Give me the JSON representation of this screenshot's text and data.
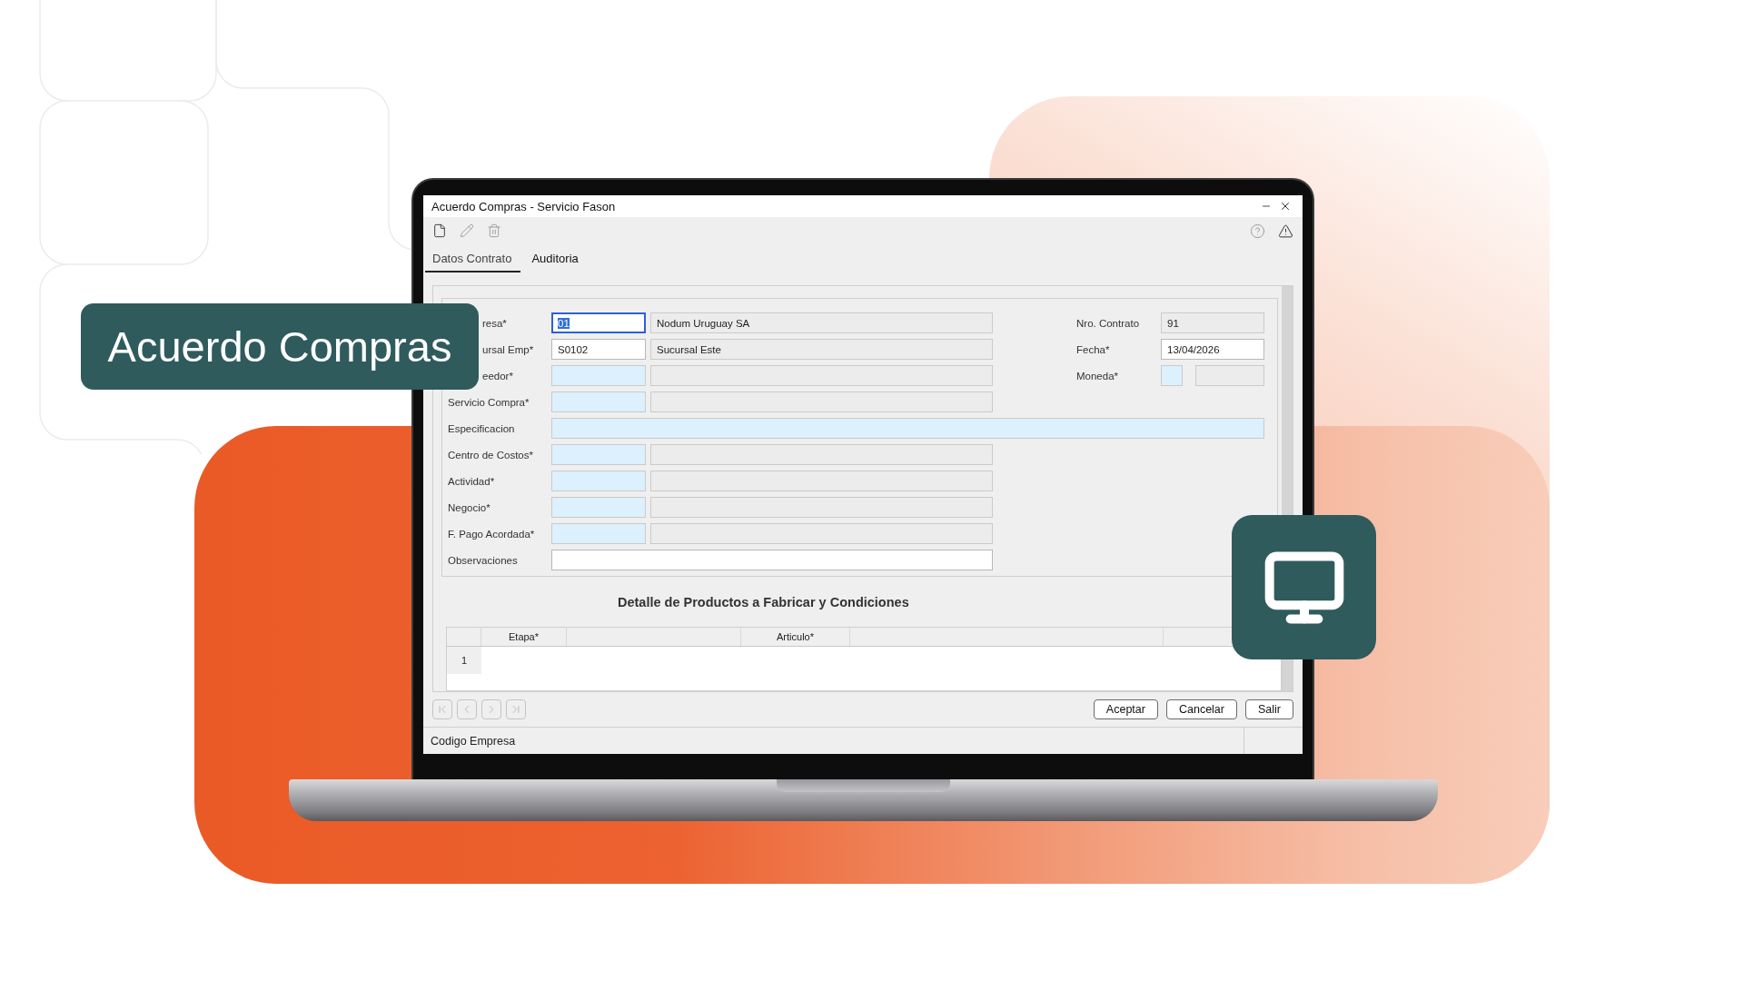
{
  "banner": {
    "title": "Acuerdo Compras"
  },
  "window": {
    "title": "Acuerdo Compras - Servicio Fason"
  },
  "tabs": [
    {
      "label": "Datos Contrato",
      "selected": true
    },
    {
      "label": "Auditoria",
      "selected": false
    }
  ],
  "form": {
    "rows": [
      {
        "kind": "pair",
        "label": "resa*",
        "covered": true,
        "code": {
          "kind": "input",
          "value": "01",
          "focused": true
        },
        "description": {
          "kind": "readonly",
          "value": "Nodum Uruguay SA"
        }
      },
      {
        "kind": "pair",
        "label": "ursal Emp*",
        "covered": true,
        "code": {
          "kind": "input",
          "value": "S0102",
          "focused": false
        },
        "description": {
          "kind": "readonly",
          "value": "Sucursal Este"
        }
      },
      {
        "kind": "pair",
        "label": "eedor*",
        "covered": true,
        "code": {
          "kind": "required",
          "focused": false
        },
        "description": {
          "kind": "readonly"
        }
      },
      {
        "kind": "pair",
        "label": "Servicio Compra*",
        "code": {
          "kind": "required",
          "focused": false
        },
        "description": {
          "kind": "readonly"
        }
      },
      {
        "kind": "wide",
        "label": "Especificacion",
        "code": {
          "kind": "required",
          "focused": false
        }
      },
      {
        "kind": "pair",
        "label": "Centro de Costos*",
        "code": {
          "kind": "required",
          "focused": false
        },
        "description": {
          "kind": "readonly"
        }
      },
      {
        "kind": "pair",
        "label": "Actividad*",
        "code": {
          "kind": "required",
          "focused": false
        },
        "description": {
          "kind": "readonly"
        }
      },
      {
        "kind": "pair",
        "label": "Negocio*",
        "code": {
          "kind": "required",
          "focused": false
        },
        "description": {
          "kind": "readonly"
        }
      },
      {
        "kind": "pair",
        "label": "F. Pago Acordada*",
        "code": {
          "kind": "required",
          "focused": false
        },
        "description": {
          "kind": "readonly"
        }
      },
      {
        "kind": "memo",
        "label": "Observaciones",
        "code": {
          "kind": "input",
          "focused": false
        }
      }
    ],
    "right": [
      {
        "label": "Nro. Contrato",
        "fields": [
          {
            "kind": "readonly",
            "value": "91"
          }
        ]
      },
      {
        "label": "Fecha*",
        "fields": [
          {
            "kind": "input",
            "value": "13/04/2026"
          }
        ]
      },
      {
        "label": "Moneda*",
        "fields": [
          {
            "kind": "required"
          },
          {
            "kind": "readonly"
          }
        ]
      }
    ]
  },
  "detail": {
    "title": "Detalle de Productos a Fabricar y Condiciones",
    "columns": [
      "Etapa*",
      "Articulo*"
    ],
    "rows": [
      "1"
    ]
  },
  "navigation": {
    "disabled": true
  },
  "buttons": [
    "Aceptar",
    "Cancelar",
    "Salir"
  ],
  "status_bar": {
    "text": "Codigo Empresa"
  }
}
